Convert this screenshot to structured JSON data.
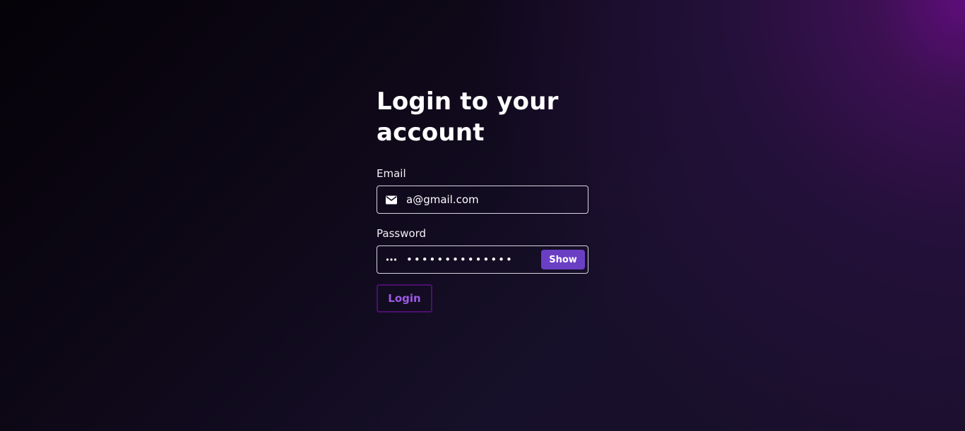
{
  "login": {
    "title": "Login to your account",
    "email": {
      "label": "Email",
      "value": "a@gmail.com",
      "icon": "envelope-icon"
    },
    "password": {
      "label": "Password",
      "value": "••••••••••••••",
      "icon": "ellipsis-icon",
      "show_label": "Show"
    },
    "submit_label": "Login"
  },
  "colors": {
    "accent": "#6b3fc4",
    "login_text": "#9d5ae6",
    "login_border": "#4b0f6e",
    "corner_glow": "#5e0d7a"
  }
}
